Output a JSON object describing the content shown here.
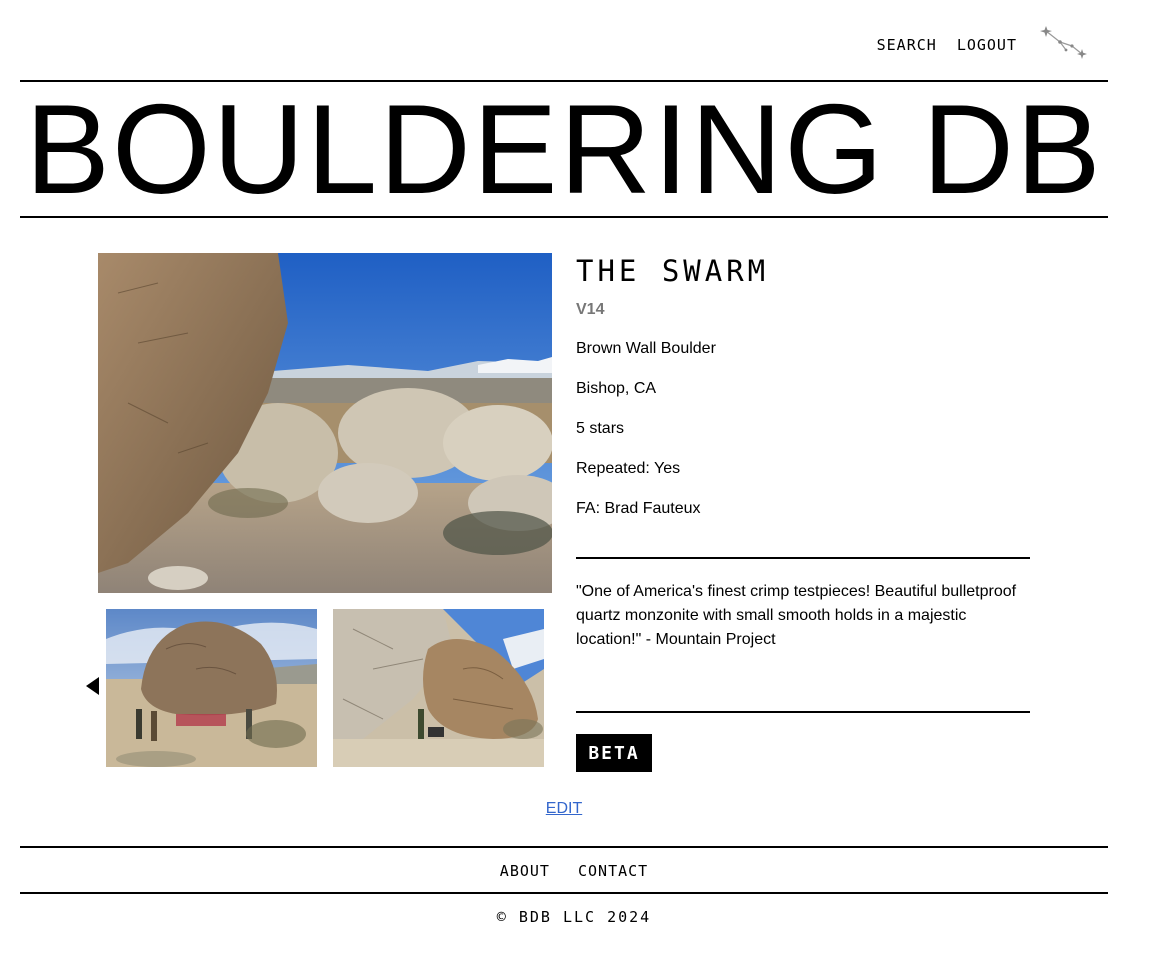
{
  "header": {
    "nav": [
      "SEARCH",
      "LOGOUT"
    ],
    "logo_icon": "constellation-icon",
    "site_title": "BOULDERING DB"
  },
  "problem": {
    "name": "THE SWARM",
    "grade": "V14",
    "boulder": "Brown Wall Boulder",
    "location": "Bishop, CA",
    "rating": "5 stars",
    "repeated": "Repeated: Yes",
    "fa": "FA: Brad Fauteux",
    "description": "\"One of America's finest crimp testpieces! Beautiful bulletproof quartz monzonite with small smooth holds in a majestic location!\" - Mountain Project",
    "beta_label": "BETA"
  },
  "gallery": {
    "prev_icon": "triangle-left-icon"
  },
  "edit_label": "EDIT",
  "footer": {
    "nav": [
      "ABOUT",
      "CONTACT"
    ],
    "copyright": "© BDB LLC 2024"
  },
  "colors": {
    "link": "#3366cc",
    "grade": "#777777",
    "button_bg": "#000000"
  }
}
